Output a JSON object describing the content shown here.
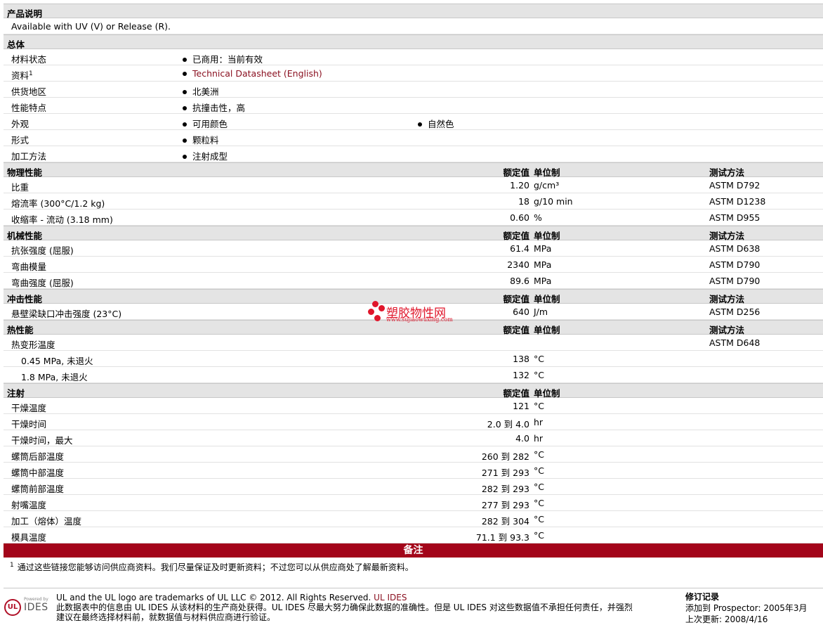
{
  "sections": {
    "desc": {
      "title": "产品说明",
      "text": "Available with UV (V) or Release (R)."
    },
    "general": {
      "title": "总体",
      "rows": [
        {
          "label": "材料状态",
          "v1": "已商用：当前有效"
        },
        {
          "label": "资料",
          "sup": "1",
          "v1": "Technical Datasheet (English)"
        },
        {
          "label": "供货地区",
          "v1": "北美洲"
        },
        {
          "label": "性能特点",
          "v1": "抗撞击性，高"
        },
        {
          "label": "外观",
          "v1": "可用颜色",
          "v2": "自然色"
        },
        {
          "label": "形式",
          "v1": "颗粒料"
        },
        {
          "label": "加工方法",
          "v1": "注射成型"
        }
      ]
    },
    "col_headers": {
      "value": "额定值",
      "unit": "单位制",
      "test": "测试方法"
    },
    "physical": {
      "title": "物理性能",
      "rows": [
        {
          "label": "比重",
          "value": "1.20",
          "unit": "g/cm³",
          "test": "ASTM D792"
        },
        {
          "label": "熔流率 (300°C/1.2 kg)",
          "value": "18",
          "unit": "g/10 min",
          "test": "ASTM D1238"
        },
        {
          "label": "收缩率 - 流动 (3.18 mm)",
          "value": "0.60",
          "unit": "%",
          "test": "ASTM D955"
        }
      ]
    },
    "mechanical": {
      "title": "机械性能",
      "rows": [
        {
          "label": "抗张强度 (屈服)",
          "value": "61.4",
          "unit": "MPa",
          "test": "ASTM D638"
        },
        {
          "label": "弯曲模量",
          "value": "2340",
          "unit": "MPa",
          "test": "ASTM D790"
        },
        {
          "label": "弯曲强度 (屈服)",
          "value": "89.6",
          "unit": "MPa",
          "test": "ASTM D790"
        }
      ]
    },
    "impact": {
      "title": "冲击性能",
      "rows": [
        {
          "label": "悬壁梁缺口冲击强度 (23°C)",
          "value": "640",
          "unit": "J/m",
          "test": "ASTM D256"
        }
      ]
    },
    "thermal": {
      "title": "热性能",
      "rows": [
        {
          "label": "热变形温度",
          "value": "",
          "unit": "",
          "test": "ASTM D648"
        },
        {
          "label": "0.45 MPa, 未退火",
          "value": "138",
          "unit": "°C",
          "test": ""
        },
        {
          "label": "1.8 MPa, 未退火",
          "value": "132",
          "unit": "°C",
          "test": ""
        }
      ]
    },
    "injection": {
      "title": "注射",
      "rows": [
        {
          "label": "干燥温度",
          "value": "121",
          "unit": "°C"
        },
        {
          "label": "干燥时间",
          "value": "2.0 到  4.0",
          "unit": "hr"
        },
        {
          "label": "干燥时间，最大",
          "value": "4.0",
          "unit": "hr"
        },
        {
          "label": "螺筒后部温度",
          "value": "260 到  282",
          "unit": "°C"
        },
        {
          "label": "螺筒中部温度",
          "value": "271 到  293",
          "unit": "°C"
        },
        {
          "label": "螺筒前部温度",
          "value": "282 到  293",
          "unit": "°C"
        },
        {
          "label": "射嘴温度",
          "value": "277 到  293",
          "unit": "°C"
        },
        {
          "label": "加工（熔体）温度",
          "value": "282 到  304",
          "unit": "°C"
        },
        {
          "label": "模具温度",
          "value": "71.1 到  93.3",
          "unit": "°C"
        }
      ]
    },
    "notes": {
      "title": "备注",
      "sup": "1",
      "text": "通过这些链接您能够访问供应商资料。我们尽量保证及时更新资料；不过您可以从供应商处了解最新资料。"
    }
  },
  "footer": {
    "logo_powered": "Powered by",
    "logo_ul": "UL",
    "logo_ides": "IDES",
    "line1": "UL and the UL logo are trademarks of UL LLC © 2012. All Rights Reserved. ",
    "line1_link": "UL IDES",
    "line2": "此数据表中的信息由  UL IDES 从该材料的生产商处获得。UL IDES 尽最大努力确保此数据的准确性。但是  UL IDES 对这些数据值不承担任何责任，并强烈",
    "line3": "建议在最终选择材料前，就数据值与材料供应商进行验证。",
    "rev_title": "修订记录",
    "rev_added": "添加到  Prospector:    2005年3月",
    "rev_updated": "上次更新:     2008/4/16"
  },
  "watermark": {
    "name": "塑胶物性网",
    "url": "www.sujiaowuxing.com"
  }
}
